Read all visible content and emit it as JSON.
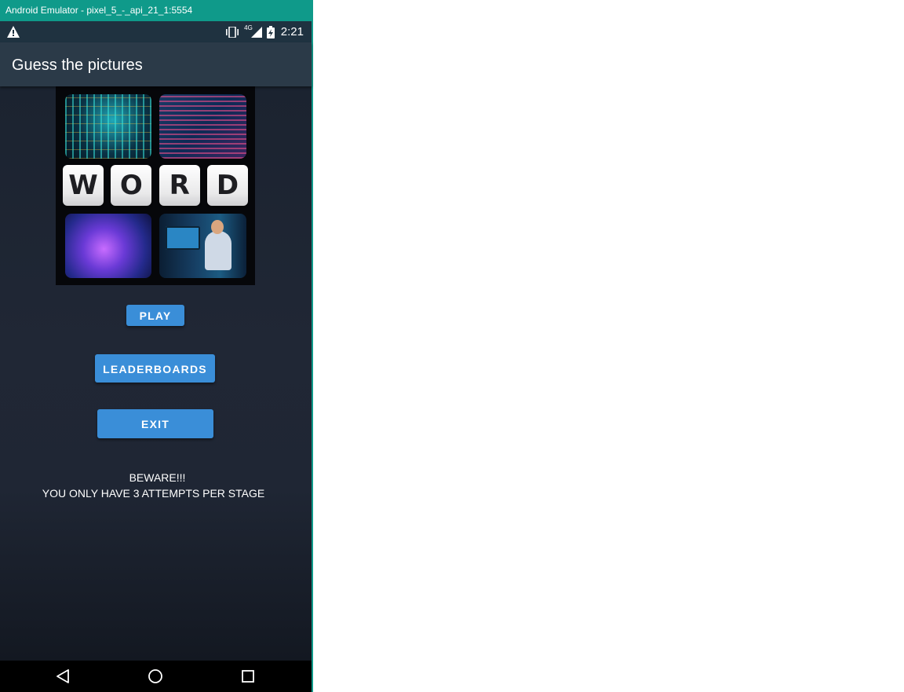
{
  "emulator": {
    "title": "Android Emulator - pixel_5_-_api_21_1:5554"
  },
  "status_bar": {
    "time": "2:21",
    "network": "4G",
    "icons": [
      "warning-icon",
      "vibrate-icon",
      "signal-icon",
      "battery-charging-icon"
    ]
  },
  "app_bar": {
    "title": "Guess the pictures"
  },
  "hero": {
    "word_tiles": [
      "W",
      "O",
      "R",
      "D"
    ]
  },
  "buttons": {
    "play": "PLAY",
    "leaderboards": "LEADERBOARDS",
    "exit": "EXIT"
  },
  "warning": {
    "line1": "BEWARE!!!",
    "line2": "YOU ONLY HAVE 3 ATTEMPTS PER STAGE"
  },
  "nav_bar": {
    "icons": [
      "back-icon",
      "home-icon",
      "recents-icon"
    ]
  },
  "colors": {
    "emulator_titlebar": "#0f9a8a",
    "app_bar": "#2b3a48",
    "button": "#3a8ed8",
    "background": "#1f2634"
  }
}
